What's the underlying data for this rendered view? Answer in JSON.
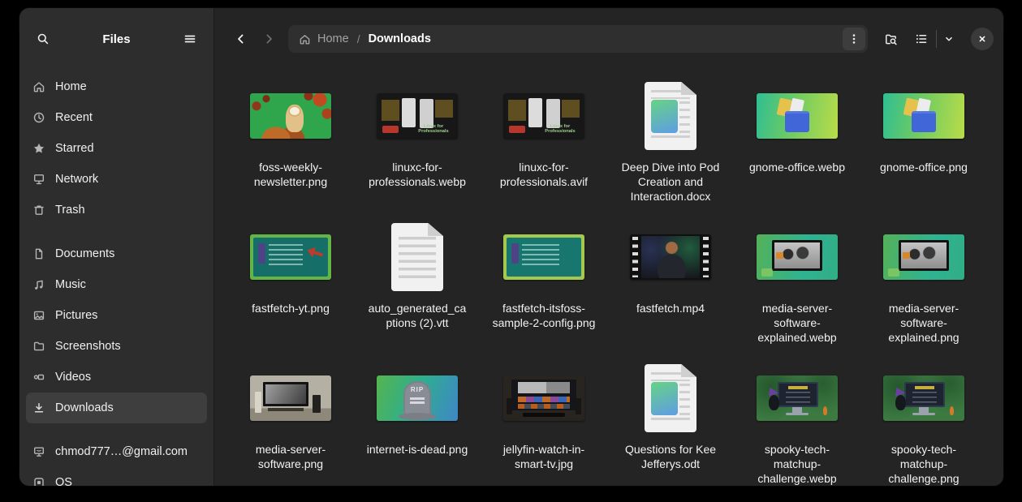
{
  "app": {
    "title": "Files"
  },
  "sidebar": {
    "title": "Files",
    "items": [
      {
        "label": "Home"
      },
      {
        "label": "Recent"
      },
      {
        "label": "Starred"
      },
      {
        "label": "Network"
      },
      {
        "label": "Trash"
      }
    ],
    "places": [
      {
        "label": "Documents"
      },
      {
        "label": "Music"
      },
      {
        "label": "Pictures"
      },
      {
        "label": "Screenshots"
      },
      {
        "label": "Videos"
      },
      {
        "label": "Downloads",
        "selected": true
      }
    ],
    "locations": [
      {
        "label": "chmod777…@gmail.com"
      },
      {
        "label": "OS"
      }
    ]
  },
  "header": {
    "breadcrumb": {
      "root": "Home",
      "separator": "/",
      "current": "Downloads"
    }
  },
  "files": [
    {
      "name": "foss-weekly-newsletter.png",
      "kind": "image"
    },
    {
      "name": "linuxc-for-professionals.webp",
      "kind": "image",
      "thumb_text": "Linux for Professionals"
    },
    {
      "name": "linuxc-for-professionals.avif",
      "kind": "image",
      "thumb_text": "Linux for Professionals"
    },
    {
      "name": "Deep Dive into Pod Creation and Interaction.docx",
      "kind": "document"
    },
    {
      "name": "gnome-office.webp",
      "kind": "image"
    },
    {
      "name": "gnome-office.png",
      "kind": "image"
    },
    {
      "name": "fastfetch-yt.png",
      "kind": "image"
    },
    {
      "name": "auto_generated_captions (2).vtt",
      "kind": "document"
    },
    {
      "name": "fastfetch-itsfoss-sample-2-config.png",
      "kind": "image"
    },
    {
      "name": "fastfetch.mp4",
      "kind": "video"
    },
    {
      "name": "media-server-software-explained.webp",
      "kind": "image"
    },
    {
      "name": "media-server-software-explained.png",
      "kind": "image"
    },
    {
      "name": "media-server-software.png",
      "kind": "image"
    },
    {
      "name": "internet-is-dead.png",
      "kind": "image",
      "thumb_text": "RIP"
    },
    {
      "name": "jellyfin-watch-in-smart-tv.jpg",
      "kind": "image"
    },
    {
      "name": "Questions for Kee Jefferys.odt",
      "kind": "document"
    },
    {
      "name": "spooky-tech-matchup-challenge.webp",
      "kind": "image"
    },
    {
      "name": "spooky-tech-matchup-challenge.png",
      "kind": "image"
    }
  ],
  "colors": {
    "window_bg": "#242424",
    "sidebar_bg": "#2d2d2d",
    "selection_bg": "#3e3e3e"
  }
}
